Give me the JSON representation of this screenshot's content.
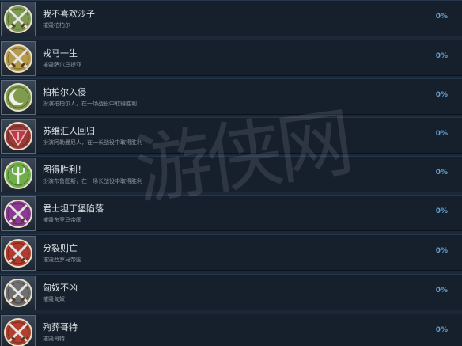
{
  "achievements": [
    {
      "title": "我不喜欢沙子",
      "desc": "摧毁柏柏尔",
      "percent": "0%",
      "icon": "crossed-swords-icon",
      "color": "#7e9a52"
    },
    {
      "title": "戎马一生",
      "desc": "摧毁萨尔马提亚",
      "percent": "0%",
      "icon": "crossed-swords-icon",
      "color": "#b49a49"
    },
    {
      "title": "柏柏尔入侵",
      "desc": "扮演柏柏尔人，在一场战役中取得胜利",
      "percent": "0%",
      "icon": "crescent-moon-icon",
      "color": "#7f9c4e"
    },
    {
      "title": "苏维汇人回归",
      "desc": "扮演阿勒曼尼人，在一长战役中取得胜利",
      "percent": "0%",
      "icon": "red-triangle-emblem-icon",
      "color": "#9a3b38"
    },
    {
      "title": "图得胜利！",
      "desc": "扮演布鲁图斯，在一场长战役中取得胜利",
      "percent": "0%",
      "icon": "trident-icon",
      "color": "#6fae4b"
    },
    {
      "title": "君士坦丁堡陷落",
      "desc": "摧毁东罗马帝国",
      "percent": "0%",
      "icon": "crossed-swords-icon",
      "color": "#8a3a91"
    },
    {
      "title": "分裂则亡",
      "desc": "摧毁西罗马帝国",
      "percent": "0%",
      "icon": "crossed-swords-icon",
      "color": "#b23a2e"
    },
    {
      "title": "匈奴不凶",
      "desc": "摧毁匈奴",
      "percent": "0%",
      "icon": "crossed-swords-icon",
      "color": "#6f6f6f"
    },
    {
      "title": "殉葬哥特",
      "desc": "摧毁哥特",
      "percent": "0%",
      "icon": "crossed-swords-icon",
      "color": "#b2402e"
    }
  ]
}
